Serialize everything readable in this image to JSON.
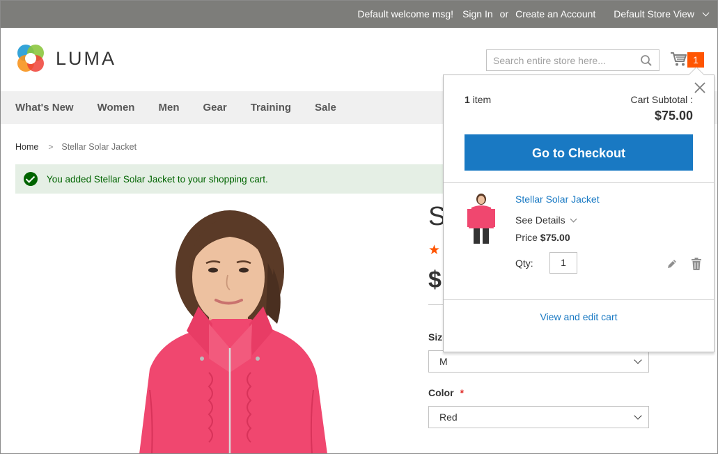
{
  "header_links": {
    "welcome": "Default welcome msg!",
    "sign_in": "Sign In",
    "or": "or",
    "create_account": "Create an Account",
    "store_view": "Default Store View"
  },
  "logo": {
    "text": "LUMA"
  },
  "search": {
    "placeholder": "Search entire store here..."
  },
  "cart": {
    "count": "1"
  },
  "nav": [
    "What's New",
    "Women",
    "Men",
    "Gear",
    "Training",
    "Sale"
  ],
  "breadcrumb": {
    "home": "Home",
    "separator": ">",
    "current": "Stellar Solar Jacket"
  },
  "message": {
    "text": "You added Stellar Solar Jacket to your shopping cart."
  },
  "product": {
    "title_partial": "S",
    "stars_partial": "★",
    "price_partial": "$",
    "size_label_partial": "Size",
    "size_value": "M",
    "color_label": "Color",
    "color_required": "*",
    "color_value": "Red"
  },
  "minicart": {
    "item_count": "1",
    "item_word": "item",
    "subtotal_label": "Cart Subtotal :",
    "subtotal": "$75.00",
    "checkout_label": "Go to Checkout",
    "item": {
      "name": "Stellar Solar Jacket",
      "see_details": "See Details",
      "price_label": "Price",
      "price": "$75.00",
      "qty_label": "Qty:",
      "qty": "1"
    },
    "view_edit": "View and edit cart"
  },
  "colors": {
    "top_bar": "#7d7d7a",
    "nav_bg": "#f0f0f0",
    "accent_blue": "#1979c3",
    "badge_orange": "#ff5501",
    "success_bg": "#e5efe5",
    "success_text": "#006400",
    "jacket_pink": "#f0476f"
  },
  "icons": [
    "search-icon",
    "cart-icon",
    "close-icon",
    "edit-icon",
    "trash-icon",
    "checkmark-icon",
    "chevron-down-icon"
  ]
}
